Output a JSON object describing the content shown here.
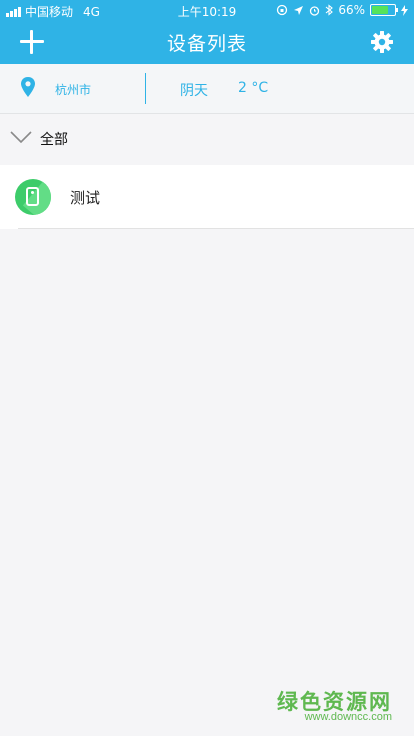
{
  "status_bar": {
    "carrier": "中国移动",
    "network": "4G",
    "time": "上午10:19",
    "battery_percent": "66%",
    "battery_level": 0.66
  },
  "header": {
    "title": "设备列表",
    "add_icon": "plus-icon",
    "settings_icon": "gear-icon"
  },
  "weather_bar": {
    "location_icon": "location-pin-icon",
    "city": "杭州市",
    "condition": "阴天",
    "temperature": "2 °C"
  },
  "group": {
    "label": "全部",
    "expanded": true
  },
  "devices": [
    {
      "name": "测试",
      "icon": "phone-device-icon"
    }
  ],
  "watermark": {
    "title": "绿色资源网",
    "url": "www.downcc.com"
  },
  "colors": {
    "accent": "#2fb3e6",
    "device_icon": "#3dcc6a",
    "watermark": "#5fb850",
    "background": "#f5f5f7"
  }
}
